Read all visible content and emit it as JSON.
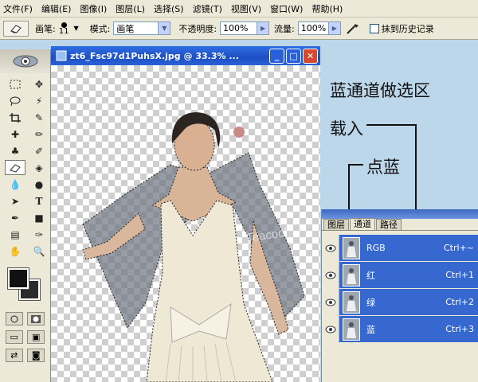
{
  "menubar": {
    "items": [
      "文件(F)",
      "编辑(E)",
      "图像(I)",
      "图层(L)",
      "选择(S)",
      "滤镜(T)",
      "视图(V)",
      "窗口(W)",
      "帮助(H)"
    ]
  },
  "options": {
    "brush_label": "画笔:",
    "brush_size": "11",
    "mode_label": "模式:",
    "mode_value": "画笔",
    "opacity_label": "不透明度:",
    "opacity_value": "100%",
    "flow_label": "流量:",
    "flow_value": "100%",
    "history_label": "抹到历史记录"
  },
  "document": {
    "title": "zt6_Fsc97d1PuhsX.jpg @ 33.3% ...",
    "watermark": "Teacool"
  },
  "annotations": {
    "line1": "蓝通道做选区",
    "line2": "载入",
    "line3": "点蓝"
  },
  "panel": {
    "tabs": [
      "图层",
      "通道",
      "路径"
    ],
    "active_tab": "通道",
    "channels": [
      {
        "name": "RGB",
        "shortcut": "Ctrl+~"
      },
      {
        "name": "红",
        "shortcut": "Ctrl+1"
      },
      {
        "name": "绿",
        "shortcut": "Ctrl+2"
      },
      {
        "name": "蓝",
        "shortcut": "Ctrl+3"
      }
    ]
  },
  "colors": {
    "title_blue": "#1c4fc4",
    "channel_highlight": "#3768d0",
    "workspace": "#bcd6ea",
    "chrome": "#ece9d8"
  }
}
